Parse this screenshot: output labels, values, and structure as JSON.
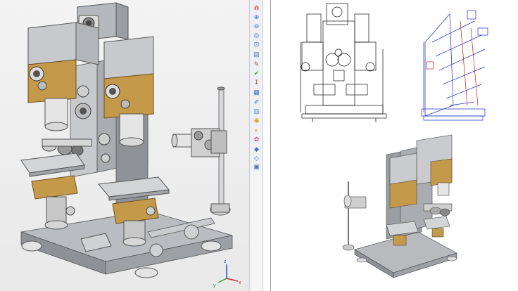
{
  "app": {
    "viewport_main": "main-3d-view",
    "sheet": "drawing-sheet"
  },
  "toolbar": {
    "tools": [
      {
        "name": "magnet-icon",
        "glyph": "⋒",
        "color": "#d8342c"
      },
      {
        "name": "zoom-in-icon",
        "glyph": "⊕",
        "color": "#3a6fc0"
      },
      {
        "name": "zoom-out-icon",
        "glyph": "⊖",
        "color": "#3a6fc0"
      },
      {
        "name": "zoom-fit-icon",
        "glyph": "◎",
        "color": "#3a6fc0"
      },
      {
        "name": "zoom-window-icon",
        "glyph": "⊡",
        "color": "#3a6fc0"
      },
      {
        "name": "sheet-icon",
        "glyph": "▤",
        "color": "#5b6f9a"
      },
      {
        "name": "edit-icon",
        "glyph": "✎",
        "color": "#8a5b2e"
      },
      {
        "name": "check-icon",
        "glyph": "✔",
        "color": "#2f9a3d"
      },
      {
        "name": "dimension-icon",
        "glyph": "↧",
        "color": "#c03a3a"
      },
      {
        "name": "layers-icon",
        "glyph": "▦",
        "color": "#3a6fc0"
      },
      {
        "name": "annotation-icon",
        "glyph": "✐",
        "color": "#3a6fc0"
      },
      {
        "name": "section-icon",
        "glyph": "▥",
        "color": "#5b8fd6"
      },
      {
        "name": "render-icon",
        "glyph": "◉",
        "color": "#e0a21f"
      },
      {
        "name": "shade-icon",
        "glyph": "◐",
        "color": "#e0a21f"
      },
      {
        "name": "palette-icon",
        "glyph": "✿",
        "color": "#d24f8a"
      },
      {
        "name": "color-icon",
        "glyph": "◆",
        "color": "#3a6fc0"
      },
      {
        "name": "transparency-icon",
        "glyph": "◇",
        "color": "#3a6fc0"
      },
      {
        "name": "camera-icon",
        "glyph": "▣",
        "color": "#5b6f9a"
      },
      {
        "name": "print-icon",
        "glyph": "⎙",
        "color": "#5b6f9a"
      }
    ]
  },
  "colors": {
    "frame_gray": "#a9acb0",
    "frame_light": "#d6d8db",
    "bronze": "#c49a4a",
    "drawing_blue": "#1a2cc8",
    "drawing_red": "#c81a1a"
  }
}
